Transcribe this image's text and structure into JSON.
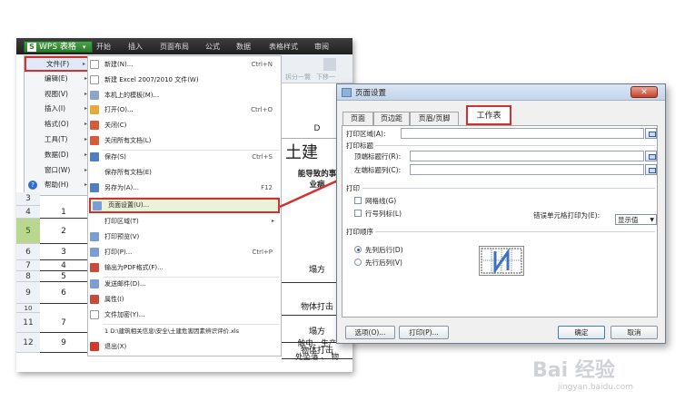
{
  "app": {
    "brand": "WPS 表格",
    "ribbon_tabs": [
      "开始",
      "插入",
      "页面布局",
      "公式",
      "数据",
      "表格样式",
      "审阅"
    ],
    "ribbon_faint": [
      "拆分一覽",
      "下移一"
    ]
  },
  "file_menu": {
    "items": [
      {
        "label": "文件(F)",
        "arrow": "▸"
      },
      {
        "label": "编辑(E)",
        "arrow": "▸"
      },
      {
        "label": "视图(V)",
        "arrow": "▸"
      },
      {
        "label": "插入(I)",
        "arrow": "▸"
      },
      {
        "label": "格式(O)",
        "arrow": "▸"
      },
      {
        "label": "工具(T)",
        "arrow": "▸"
      },
      {
        "label": "数据(D)",
        "arrow": "▸"
      },
      {
        "label": "窗口(W)",
        "arrow": "▸"
      },
      {
        "label": "帮助(H)",
        "arrow": "▸"
      }
    ]
  },
  "submenu": {
    "items": [
      {
        "label": "新建(N)...",
        "shortcut": "Ctrl+N",
        "icon_color": "#ffffff"
      },
      {
        "label": "新建 Excel 2007/2010 文件(W)",
        "shortcut": "",
        "icon_color": "#ffffff"
      },
      {
        "label": "本机上的模板(M)...",
        "shortcut": "",
        "icon_color": "#8aa6c8"
      },
      {
        "label": "打开(O)...",
        "shortcut": "Ctrl+O",
        "icon_color": "#e6a93a"
      },
      {
        "label": "关闭(C)",
        "shortcut": "",
        "icon_color": "#d85b3b"
      },
      {
        "label": "关闭所有文档(L)",
        "shortcut": "",
        "icon_color": "#d85b3b"
      },
      {
        "label": "保存(S)",
        "shortcut": "Ctrl+S",
        "icon_color": "#4f7fc0"
      },
      {
        "label": "保存所有文档(E)",
        "shortcut": "",
        "icon_color": "#ffffff"
      },
      {
        "label": "另存为(A)...",
        "shortcut": "F12",
        "icon_color": "#4f7fc0"
      },
      {
        "label": "页面设置(U)...",
        "shortcut": "",
        "icon_color": "#7a9fd4"
      },
      {
        "label": "打印区域(T)",
        "shortcut": "▸",
        "icon_color": "#ffffff"
      },
      {
        "label": "打印预览(V)",
        "shortcut": "",
        "icon_color": "#7a9fd4"
      },
      {
        "label": "打印(P)...",
        "shortcut": "Ctrl+P",
        "icon_color": "#7a9fd4"
      },
      {
        "label": "输出为PDF格式(F)...",
        "shortcut": "",
        "icon_color": "#c94a3a"
      },
      {
        "label": "发送邮件(D)...",
        "shortcut": "",
        "icon_color": "#7a9fd4"
      },
      {
        "label": "属性(I)",
        "shortcut": "",
        "icon_color": "#c94a3a"
      },
      {
        "label": "文件加密(Y)...",
        "shortcut": "",
        "icon_color": "#ffffff"
      },
      {
        "label": "1 D:\\建筑相关信息\\安全\\土建危害因素辨识评价.xls",
        "shortcut": "",
        "icon_color": "#ffffff"
      },
      {
        "label": "退出(X)",
        "shortcut": "",
        "icon_color": "#d23a2a"
      }
    ]
  },
  "sheet": {
    "column_d": "D",
    "title_fragment": "土建",
    "header_fragment_1": "能导致的事",
    "header_fragment_2": "业病",
    "rows": [
      {
        "num": "3",
        "a": ""
      },
      {
        "num": "4",
        "a": "1"
      },
      {
        "num": "5",
        "a": "2"
      },
      {
        "num": "6",
        "a": "3"
      },
      {
        "num": "7",
        "a": "4"
      },
      {
        "num": "8",
        "a": "5"
      },
      {
        "num": "9",
        "a": "6"
      },
      {
        "num": "10",
        "a": ""
      },
      {
        "num": "11",
        "a": "7"
      },
      {
        "num": "12",
        "a": "9"
      }
    ],
    "right_cells": [
      "塌方",
      "物体打击",
      "塌方",
      "物体打击",
      "触电、生产",
      "处坠落 、 物"
    ]
  },
  "dialog": {
    "title": "页面设置",
    "close_label": "✕",
    "tabs": [
      "页面",
      "页边距",
      "页眉/页脚",
      "工作表"
    ],
    "print_area_label": "打印区域(A):",
    "print_titles_group": "打印标题",
    "top_rows_label": "顶端标题行(R):",
    "left_cols_label": "左端标题列(C):",
    "print_group": "打印",
    "gridlines_label": "网格线(G)",
    "row_col_headings_label": "行号列标(L)",
    "cell_errors_label": "错误单元格打印为(E):",
    "cell_errors_value": "显示值",
    "page_order_group": "打印顺序",
    "down_then_over_label": "先列后行(D)",
    "over_then_down_label": "先行后列(V)",
    "options_button": "选项(O)...",
    "print_button": "打印(P)...",
    "ok_button": "确定",
    "cancel_button": "取消"
  },
  "watermark": {
    "text": "Bai 经验",
    "url": "jingyan.baidu.com"
  },
  "colors": {
    "accent_red": "#d3312f",
    "wps_green": "#3a8f3a",
    "selected_row": "#b9d78f"
  }
}
